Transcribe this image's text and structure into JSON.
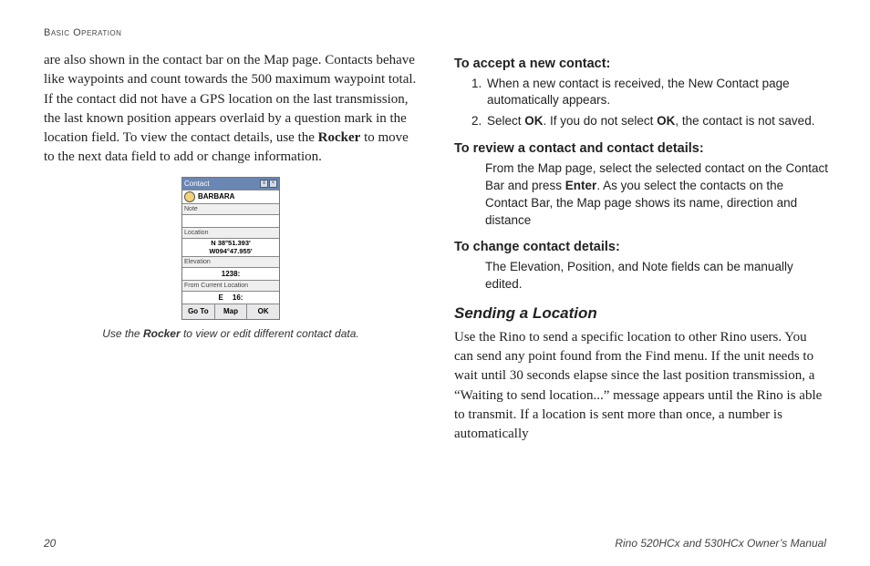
{
  "header": "Basic Operation",
  "left": {
    "paragraph_parts": {
      "p1": "are also shown in the contact bar on the Map page. Contacts behave like waypoints and count towards the 500 maximum waypoint total. If the contact did not have a GPS location on the last transmission, the last known position appears overlaid by a question mark in the location field. To view the contact details, use the ",
      "bold": "Rocker",
      "p2": " to move to the next data field to add or change information."
    },
    "device": {
      "title": "Contact",
      "name": "BARBARA",
      "labels": {
        "note": "Note",
        "location": "Location",
        "elevation": "Elevation",
        "from_current": "From Current Location"
      },
      "location_lines": [
        "N 38°51.393'",
        "W094°47.955'"
      ],
      "elevation_value": "1238:",
      "from_current_values": {
        "dir": "E",
        "bearing": "16:"
      },
      "buttons": [
        "Go To",
        "Map",
        "OK"
      ]
    },
    "caption": {
      "pre": "Use the ",
      "bold": "Rocker",
      "post": " to view or edit different contact data."
    }
  },
  "right": {
    "accept": {
      "head": "To accept a new contact:",
      "items": [
        {
          "text": "When a new contact is received, the New Contact page automatically appears."
        },
        {
          "pre": "Select ",
          "b1": "OK",
          "mid": ". If you do not select ",
          "b2": "OK",
          "post": ", the contact is not saved."
        }
      ]
    },
    "review": {
      "head": "To review a contact and contact details:",
      "body_pre": "From the Map page, select the selected contact on the Contact Bar and press ",
      "body_bold": "Enter",
      "body_post": ". As you select the contacts on the Contact Bar, the Map page shows its name, direction and distance"
    },
    "change": {
      "head": "To change contact details:",
      "body": "The Elevation, Position, and Note fields can be manually edited."
    },
    "sending": {
      "head": "Sending a Location",
      "body": "Use the Rino to send a specific location to other Rino users. You can send any point found from the Find menu. If the unit needs to wait until 30 seconds elapse since the last position transmission, a “Waiting to send location...” message appears until the Rino is able to transmit. If a location is sent more than once, a number is automatically"
    }
  },
  "footer": {
    "page": "20",
    "manual": "Rino 520HCx and 530HCx Owner’s Manual"
  }
}
